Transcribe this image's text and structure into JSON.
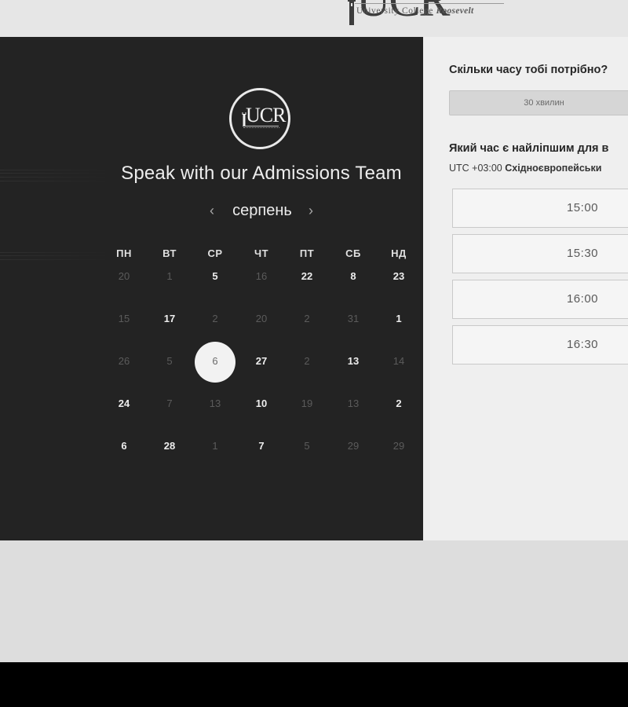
{
  "header": {
    "logo_big": "UCR",
    "logo_subtitle_prefix": "University College",
    "logo_subtitle_name": "Roosevelt"
  },
  "calendar": {
    "logo_text": "UCR",
    "title": "Speak with our Admissions Team",
    "prev_icon": "‹",
    "next_icon": "›",
    "month": "серпень",
    "weekdays": [
      "ПН",
      "ВТ",
      "СР",
      "ЧТ",
      "ПТ",
      "СБ",
      "НД"
    ],
    "weeks": [
      [
        {
          "d": "20",
          "s": "muted"
        },
        {
          "d": "1",
          "s": "muted"
        },
        {
          "d": "5",
          "s": "active"
        },
        {
          "d": "16",
          "s": "muted"
        },
        {
          "d": "22",
          "s": "active"
        },
        {
          "d": "8",
          "s": "active"
        },
        {
          "d": "23",
          "s": "active"
        }
      ],
      [
        {
          "d": "15",
          "s": "muted"
        },
        {
          "d": "17",
          "s": "active"
        },
        {
          "d": "2",
          "s": "muted"
        },
        {
          "d": "20",
          "s": "muted"
        },
        {
          "d": "2",
          "s": "muted"
        },
        {
          "d": "31",
          "s": "muted"
        },
        {
          "d": "1",
          "s": "active"
        }
      ],
      [
        {
          "d": "26",
          "s": "muted"
        },
        {
          "d": "5",
          "s": "muted"
        },
        {
          "d": "6",
          "s": "selected"
        },
        {
          "d": "27",
          "s": "active"
        },
        {
          "d": "2",
          "s": "muted"
        },
        {
          "d": "13",
          "s": "active"
        },
        {
          "d": "14",
          "s": "muted"
        }
      ],
      [
        {
          "d": "24",
          "s": "active"
        },
        {
          "d": "7",
          "s": "muted"
        },
        {
          "d": "13",
          "s": "muted"
        },
        {
          "d": "10",
          "s": "active"
        },
        {
          "d": "19",
          "s": "muted"
        },
        {
          "d": "13",
          "s": "muted"
        },
        {
          "d": "2",
          "s": "active"
        }
      ],
      [
        {
          "d": "6",
          "s": "active"
        },
        {
          "d": "28",
          "s": "active"
        },
        {
          "d": "1",
          "s": "muted"
        },
        {
          "d": "7",
          "s": "active"
        },
        {
          "d": "5",
          "s": "muted"
        },
        {
          "d": "29",
          "s": "muted"
        },
        {
          "d": "29",
          "s": "muted"
        }
      ]
    ]
  },
  "booking": {
    "duration_question": "Скільки часу тобі потрібно?",
    "duration_value": "30 хвилин",
    "time_question": "Який час є найліпшим для в",
    "timezone_prefix": "UTC +03:00",
    "timezone_name": "Східноєвропейськи",
    "slots": [
      "15:00",
      "15:30",
      "16:00",
      "16:30"
    ]
  },
  "colors": {
    "dark_panel": "#232323",
    "light_panel": "#efefef",
    "selected_day": "#f2f2f2"
  }
}
